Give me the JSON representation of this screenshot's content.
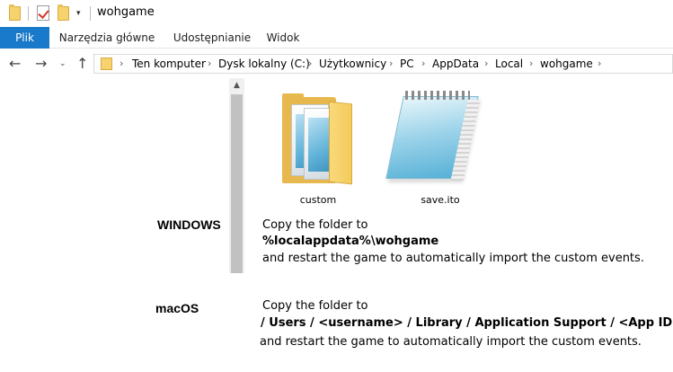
{
  "window": {
    "title": "wohgame"
  },
  "ribbon": {
    "tabs": [
      "Plik",
      "Narzędzia główne",
      "Udostępnianie",
      "Widok"
    ]
  },
  "address": {
    "crumbs": [
      "Ten komputer",
      "Dysk lokalny (C:)",
      "Użytkownicy",
      "PC",
      "AppData",
      "Local",
      "wohgame"
    ]
  },
  "files": [
    {
      "name": "custom",
      "icon": "folder-icon"
    },
    {
      "name": "save.ito",
      "icon": "notepad-file-icon"
    }
  ],
  "windows": {
    "label": "WINDOWS",
    "line1": "Copy the folder to",
    "path": "%localappdata%\\wohgame",
    "line3": "and restart the game to automatically import the custom events."
  },
  "macos": {
    "label": "macOS",
    "line1": "Copy the folder to",
    "path": "/ Users / <username> / Library / Application Support / <App ID> /",
    "line3": "and restart the game to automatically import the custom events."
  },
  "colors": {
    "accent": "#1979ca",
    "folder": "#f6d36f"
  }
}
